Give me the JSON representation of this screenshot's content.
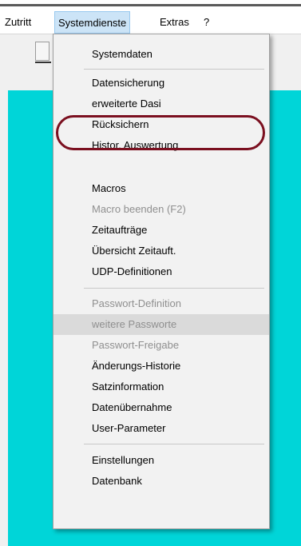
{
  "menubar": {
    "items": [
      "Zutritt",
      "Systemdienste",
      "Extras",
      "?"
    ]
  },
  "dropdown": {
    "groups": [
      [
        "Systemdaten"
      ],
      [
        "Datensicherung",
        "erweiterte Dasi",
        "Rücksichern",
        "Histor. Auswertung",
        "Macros",
        "Macro beenden (F2)",
        "Zeitaufträge",
        "Übersicht Zeitauft.",
        "UDP-Definitionen"
      ],
      [
        "Passwort-Definition",
        "weitere Passworte",
        "Passwort-Freigabe",
        "Änderungs-Historie",
        "Satzinformation",
        "Datenübernahme",
        "User-Parameter"
      ],
      [
        "Einstellungen",
        "Datenbank"
      ]
    ],
    "disabled_items": [
      "Macro beenden (F2)",
      "Passwort-Definition",
      "weitere Passworte",
      "Passwort-Freigabe"
    ],
    "hovered_item": "weitere Passworte",
    "circled_item": "Histor. Auswertung"
  },
  "colors": {
    "workspace": "#00d5d8",
    "menu_bg": "#f2f2f2",
    "active_menu_bg": "#cce4f7",
    "annotation_ring": "#7b1020",
    "disabled_text": "#8f8f8f"
  }
}
